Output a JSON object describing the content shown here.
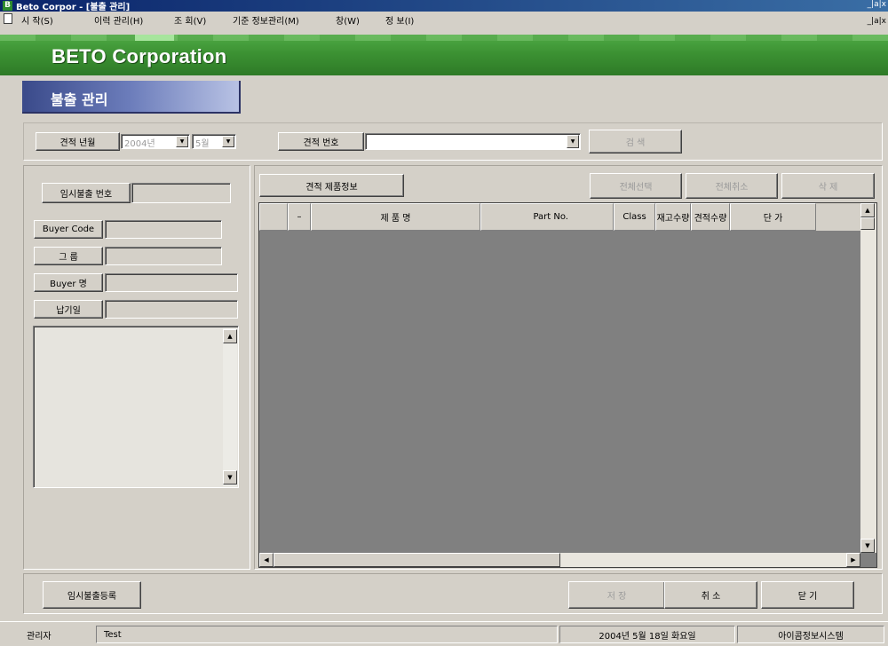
{
  "window": {
    "title": "Beto Corpor - [불출 관리]",
    "app_icon": "B"
  },
  "menubar": {
    "items": [
      "시 작(S)",
      "이력 관리(H)",
      "조 회(V)",
      "기준 정보관리(M)",
      "창(W)",
      "정 보(I)"
    ],
    "mdi_controls": "_|a|x"
  },
  "banner": {
    "brand": "BETO Corporation",
    "brand_color": "#3c9233"
  },
  "page": {
    "title": "불출 관리",
    "title_color": "#4a5a9a"
  },
  "search": {
    "year_month_label": "견적 년월",
    "year_value": "2004년",
    "month_value": "5월",
    "quote_no_label": "견적 번호",
    "quote_no_value": "",
    "search_button": "검 색"
  },
  "left": {
    "temp_issue_no_label": "임시불출 번호",
    "buyer_code_label": "Buyer Code",
    "group_label": "그 룹",
    "buyer_name_label": "Buyer 명",
    "delivery_date_label": "납기일",
    "memo_value": ""
  },
  "grid": {
    "section_label": "견적 제품정보",
    "select_all_button": "전체선택",
    "deselect_all_button": "전체취소",
    "delete_button": "삭 제",
    "columns": [
      "",
      "–",
      "제 품 명",
      "Part No.",
      "Class",
      "재고수량",
      "견적수량",
      "단 가"
    ],
    "rows": []
  },
  "footer": {
    "temp_register_button": "임시불출등록",
    "save_button": "저 장",
    "cancel_button": "취 소",
    "close_button": "닫 기"
  },
  "statusbar": {
    "user_label": "관리자",
    "user_value": "Test",
    "date": "2004년 5월 18일 화요일",
    "company": "아이콤정보시스템"
  }
}
